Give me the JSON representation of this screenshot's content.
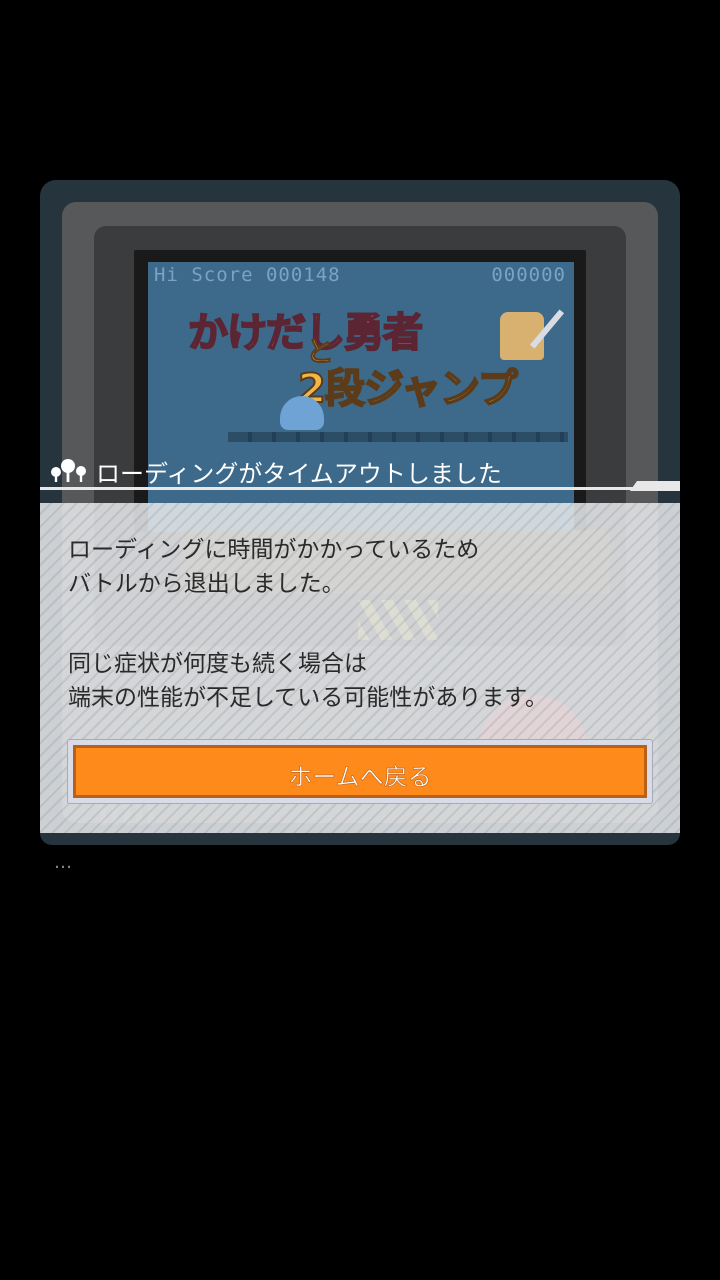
{
  "game_screen": {
    "hi_score_label": "Hi Score 000148",
    "current_score": "000000",
    "logo_line1": "かけだし勇者",
    "logo_to": "と",
    "logo_line2": "2段ジャンプ"
  },
  "dialog": {
    "title": "ローディングがタイムアウトしました",
    "message1": [
      "ローディングに時間がかかっているため",
      "バトルから退出しました。"
    ],
    "message2": [
      "同じ症状が何度も続く場合は",
      "端末の性能が不足している可能性があります。"
    ],
    "home_button_label": "ホームへ戻る"
  },
  "footer": {
    "ellipsis": "…"
  },
  "colors": {
    "accent": "#ff8a1c",
    "panel": "#e8eaec",
    "device": "#26353d"
  }
}
